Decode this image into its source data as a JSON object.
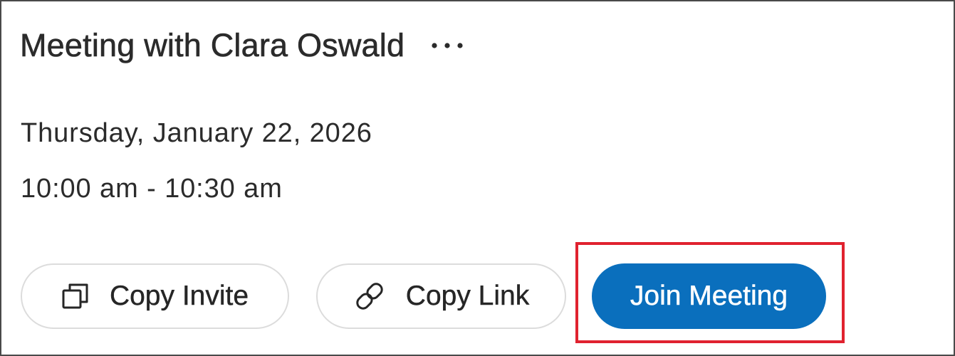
{
  "meeting": {
    "title": "Meeting with Clara Oswald",
    "date": "Thursday, January 22, 2026",
    "time": "10:00 am - 10:30 am"
  },
  "actions": {
    "more_icon": "more-horizontal-icon",
    "copy_invite": {
      "label": "Copy Invite",
      "icon": "copy-icon"
    },
    "copy_link": {
      "label": "Copy Link",
      "icon": "link-icon"
    },
    "join_meeting": {
      "label": "Join Meeting"
    }
  },
  "colors": {
    "primary": "#0a6fbd",
    "highlight": "#e0222f",
    "text": "#2b2b2b",
    "outline": "#dcdcdc"
  }
}
